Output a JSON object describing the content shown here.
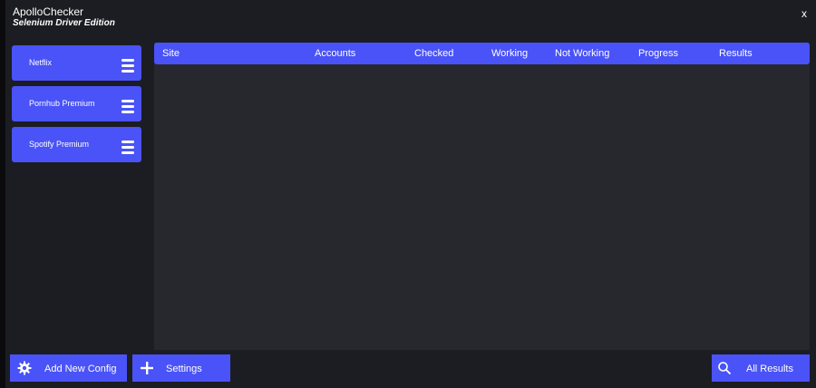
{
  "app": {
    "title": "ApolloChecker",
    "subtitle": "Selenium Driver Edition",
    "close_label": "x"
  },
  "sidebar": {
    "configs": [
      {
        "label": "Netflix"
      },
      {
        "label": "Pornhub Premium"
      },
      {
        "label": "Spotify Premium"
      }
    ]
  },
  "table": {
    "columns": [
      "Site",
      "Accounts",
      "Checked",
      "Working",
      "Not Working",
      "Progress",
      "Results"
    ],
    "rows": []
  },
  "footer": {
    "add_config_label": "Add New Config",
    "settings_label": "Settings",
    "all_results_label": "All Results"
  },
  "colors": {
    "accent": "#4a53f7",
    "background": "#1c1d23",
    "table_bg": "#26282e"
  },
  "icons": {
    "config_menu": "hamburger-icon",
    "add_config": "gear-icon",
    "settings": "plus-icon",
    "all_results": "search-icon"
  }
}
